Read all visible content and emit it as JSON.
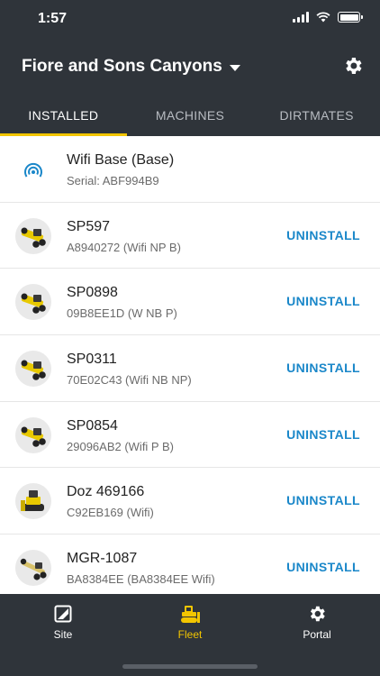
{
  "status_bar": {
    "time": "1:57"
  },
  "header": {
    "site_name": "Fiore and Sons Canyons"
  },
  "tabs": [
    {
      "label": "INSTALLED",
      "active": true
    },
    {
      "label": "MACHINES",
      "active": false
    },
    {
      "label": "DIRTMATES",
      "active": false
    }
  ],
  "rows": [
    {
      "icon": "wifi-base-icon",
      "name": "Wifi Base (Base)",
      "sub": "Serial: ABF994B9",
      "action": ""
    },
    {
      "icon": "motor-grader-icon",
      "name": "SP597",
      "sub": "A8940272 (Wifi NP B)",
      "action": "UNINSTALL"
    },
    {
      "icon": "motor-grader-icon",
      "name": "SP0898",
      "sub": "09B8EE1D (W NB P)",
      "action": "UNINSTALL"
    },
    {
      "icon": "motor-grader-icon",
      "name": "SP0311",
      "sub": "70E02C43 (Wifi NB NP)",
      "action": "UNINSTALL"
    },
    {
      "icon": "motor-grader-icon",
      "name": "SP0854",
      "sub": "29096AB2 (Wifi P B)",
      "action": "UNINSTALL"
    },
    {
      "icon": "dozer-icon",
      "name": "Doz 469166",
      "sub": "C92EB169 (Wifi)",
      "action": "UNINSTALL"
    },
    {
      "icon": "grader-icon",
      "name": "MGR-1087",
      "sub": "BA8384EE (BA8384EE Wifi)",
      "action": "UNINSTALL"
    }
  ],
  "bottom_nav": {
    "site": "Site",
    "fleet": "Fleet",
    "portal": "Portal"
  },
  "colors": {
    "header_bg": "#2f343a",
    "accent": "#f2c500",
    "link": "#1a87c9"
  }
}
